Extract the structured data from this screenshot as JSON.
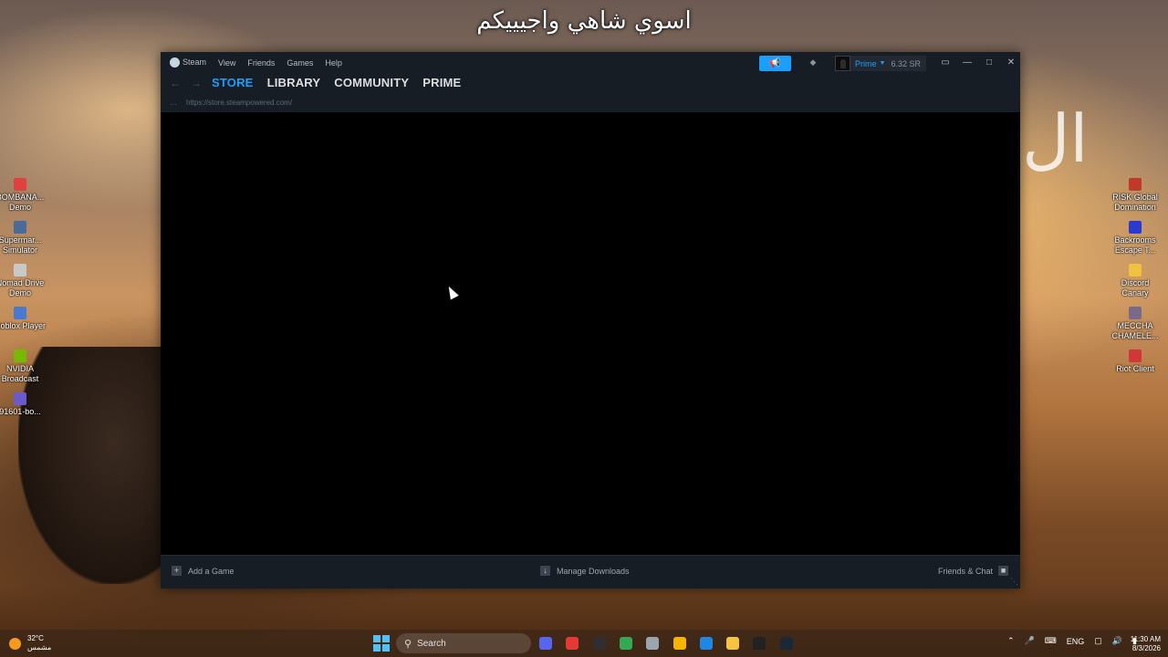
{
  "overlay_text": "اسوي شاهي واجيييكم",
  "desktop_left": [
    {
      "label": "BOMBANA... Demo",
      "color": "#e04040"
    },
    {
      "label": "Supermar... Simulator",
      "color": "#4a6a9a"
    },
    {
      "label": "Nomad Drive Demo",
      "color": "#c8c8c8"
    },
    {
      "label": "Roblox Player",
      "color": "#4a7ad0"
    },
    {
      "label": "NVIDIA Broadcast",
      "color": "#76b900"
    },
    {
      "label": "91601-bo...",
      "color": "#6a5acd"
    }
  ],
  "desktop_right": [
    {
      "label": "RISK Global Domination",
      "color": "#c0392b"
    },
    {
      "label": "Backrooms Escape T...",
      "color": "#2a3ad0"
    },
    {
      "label": "Discord Canary",
      "color": "#f0c040"
    },
    {
      "label": "MECCHA CHAMELE...",
      "color": "#7a6a8a"
    },
    {
      "label": "Riot Client",
      "color": "#d13639"
    }
  ],
  "steam": {
    "menu": [
      "Steam",
      "View",
      "Friends",
      "Games",
      "Help"
    ],
    "tabs": [
      "STORE",
      "LIBRARY",
      "COMMUNITY",
      "PRIME"
    ],
    "active_tab": "STORE",
    "url": "https://store.steampowered.com/",
    "profile_name": "Prime",
    "wallet": "6.32 SR",
    "status": {
      "add_game": "Add a Game",
      "manage_downloads": "Manage Downloads",
      "friends_chat": "Friends & Chat"
    },
    "colors": {
      "accent": "#1a9fff",
      "chrome": "#171d25"
    }
  },
  "taskbar": {
    "temperature": "32°C",
    "weather_desc": "مشمس",
    "search_placeholder": "Search",
    "language": "ENG",
    "time": "11:30 AM",
    "date": "8/3/2026",
    "apps": [
      {
        "name": "discord-icon",
        "color": "#5865f2"
      },
      {
        "name": "voice-app-icon",
        "color": "#e53935"
      },
      {
        "name": "obs-icon",
        "color": "#302e31"
      },
      {
        "name": "chrome-icon",
        "color": "#34a853"
      },
      {
        "name": "settings-icon",
        "color": "#9aa5b1"
      },
      {
        "name": "pen-app-icon",
        "color": "#f4b400"
      },
      {
        "name": "chrome-canary-icon",
        "color": "#1e88e5"
      },
      {
        "name": "file-explorer-icon",
        "color": "#f6c343"
      },
      {
        "name": "app-icon",
        "color": "#222222"
      },
      {
        "name": "steam-taskbar-icon",
        "color": "#1b2838"
      }
    ]
  }
}
